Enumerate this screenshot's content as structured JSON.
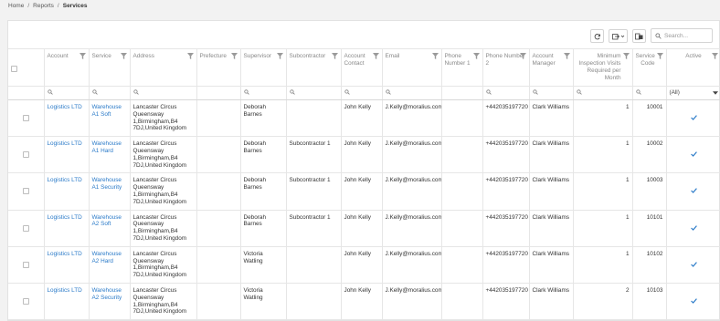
{
  "breadcrumb": {
    "items": [
      "Home",
      "Reports"
    ],
    "current": "Services"
  },
  "toolbar": {
    "refresh_icon": "refresh-icon",
    "export_icon": "export-icon",
    "columns_icon": "column-chooser-icon",
    "search_placeholder": "Search..."
  },
  "columns": {
    "account": "Account",
    "service": "Service",
    "address": "Address",
    "prefecture": "Prefecture",
    "supervisor": "Supervisor",
    "subcontractor": "Subcontractor",
    "account_contact": "Account Contact",
    "email": "Email",
    "phone1": "Phone Number 1",
    "phone2": "Phone Number 2",
    "account_manager": "Account Manager",
    "min_visits": "Minimum Inspection Visits Required per Month",
    "service_code": "Service Code",
    "active": "Active"
  },
  "filters": {
    "active_value": "(All)"
  },
  "rows": [
    {
      "account": "Logistics LTD",
      "service": "Warehouse A1 Soft",
      "address": "Lancaster Circus Queensway 1,Birmingham,B4 7DJ,United Kingdom",
      "prefecture": "",
      "supervisor": "Deborah Barnes",
      "subcontractor": "",
      "contact": "John Kelly",
      "email": "J.Kelly@moralius.com",
      "phone1": "",
      "phone2": "+442035197720",
      "manager": "Clark Williams",
      "visits": "1",
      "code": "10001",
      "active": true
    },
    {
      "account": "Logistics LTD",
      "service": "Warehouse A1 Hard",
      "address": "Lancaster Circus Queensway 1,Birmingham,B4 7DJ,United Kingdom",
      "prefecture": "",
      "supervisor": "Deborah Barnes",
      "subcontractor": "Subcontractor 1",
      "contact": "John Kelly",
      "email": "J.Kelly@moralius.com",
      "phone1": "",
      "phone2": "+442035197720",
      "manager": "Clark Williams",
      "visits": "1",
      "code": "10002",
      "active": true
    },
    {
      "account": "Logistics LTD",
      "service": "Warehouse A1 Security",
      "address": "Lancaster Circus Queensway 1,Birmingham,B4 7DJ,United Kingdom",
      "prefecture": "",
      "supervisor": "Deborah Barnes",
      "subcontractor": "Subcontractor 1",
      "contact": "John Kelly",
      "email": "J.Kelly@moralius.com",
      "phone1": "",
      "phone2": "+442035197720",
      "manager": "Clark Williams",
      "visits": "1",
      "code": "10003",
      "active": true
    },
    {
      "account": "Logistics LTD",
      "service": "Warehouse A2 Soft",
      "address": "Lancaster Circus Queensway 1,Birmingham,B4 7DJ,United Kingdom",
      "prefecture": "",
      "supervisor": "Deborah Barnes",
      "subcontractor": "Subcontractor 1",
      "contact": "John Kelly",
      "email": "J.Kelly@moralius.com",
      "phone1": "",
      "phone2": "+442035197720",
      "manager": "Clark Williams",
      "visits": "1",
      "code": "10101",
      "active": true
    },
    {
      "account": "Logistics LTD",
      "service": "Warehouse A2 Hard",
      "address": "Lancaster Circus Queensway 1,Birmingham,B4 7DJ,United Kingdom",
      "prefecture": "",
      "supervisor": "Victoria Watling",
      "subcontractor": "",
      "contact": "John Kelly",
      "email": "J.Kelly@moralius.com",
      "phone1": "",
      "phone2": "+442035197720",
      "manager": "Clark Williams",
      "visits": "1",
      "code": "10102",
      "active": true
    },
    {
      "account": "Logistics LTD",
      "service": "Warehouse A2 Security",
      "address": "Lancaster Circus Queensway 1,Birmingham,B4 7DJ,United Kingdom",
      "prefecture": "",
      "supervisor": "Victoria Watling",
      "subcontractor": "",
      "contact": "John Kelly",
      "email": "J.Kelly@moralius.com",
      "phone1": "",
      "phone2": "+442035197720",
      "manager": "Clark Williams",
      "visits": "2",
      "code": "10103",
      "active": true
    }
  ],
  "colors": {
    "link": "#2a7ac8",
    "check": "#2a7ac8",
    "border": "#e6e6e6"
  }
}
